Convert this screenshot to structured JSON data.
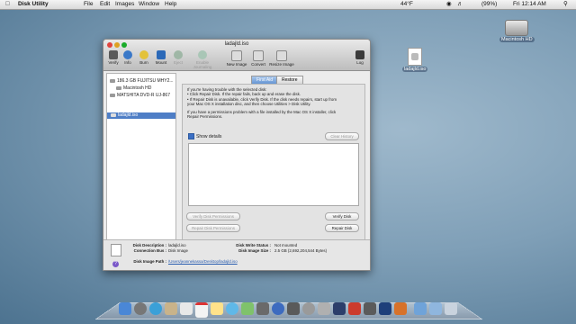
{
  "menubar": {
    "app": "Disk Utility",
    "items": [
      "File",
      "Edit",
      "Images",
      "Window",
      "Help"
    ],
    "temperature": "44°F",
    "battery": "(99%)",
    "clock": "Fri 12:14 AM"
  },
  "desktop": {
    "hd_label": "Macintosh HD",
    "file_label": "ladajld.iso"
  },
  "window": {
    "title": "ladajld.iso",
    "toolbar": [
      "Verify",
      "Info",
      "Burn",
      "Mount",
      "Eject",
      "Enable Journaling",
      "New Image",
      "Convert",
      "Resize Image",
      "Log"
    ],
    "sidebar": [
      "186.3 GB FUJITSU MHY2...",
      "Macintosh HD",
      "MATSHITA DVD-R UJ-867",
      "ladajld.iso"
    ],
    "tabs": [
      "First Aid",
      "Restore"
    ],
    "info": {
      "line1": "If you're having trouble with the selected disk:",
      "line2": "• Click Repair Disk. If the repair fails, back up and erase the disk.",
      "line3": "• If Repair Disk is unavailable, click Verify Disk. If the disk needs repairs, start up from",
      "line4": "your Mac OS X installation disc, and then choose Utilities > Disk Utility.",
      "line5": "If you have a permissions problem with a file installed by the Mac OS X installer, click",
      "line6": "Repair Permissions."
    },
    "show_details": "Show details",
    "clear_history": "Clear History",
    "buttons": {
      "verify_permissions": "Verify Disk Permissions",
      "repair_permissions": "Repair Disk Permissions",
      "verify_disk": "Verify Disk",
      "repair_disk": "Repair Disk"
    },
    "details": {
      "disk_description_label": "Disk Description :",
      "disk_description": "ladajld.iso",
      "connection_bus_label": "Connection Bus :",
      "connection_bus": "Disk Image",
      "write_status_label": "Disk Write Status :",
      "write_status": "Not mounted",
      "image_size_label": "Disk Image Size :",
      "image_size": "2.5 GB (2,692,204,544 Bytes)",
      "image_path_label": "Disk Image Path :",
      "image_path": "/Users/jeannekassa/Desktop/ladajld.iso"
    }
  },
  "colors": {
    "selection": "#4e7ec6",
    "tab_active": "#6595d3"
  }
}
